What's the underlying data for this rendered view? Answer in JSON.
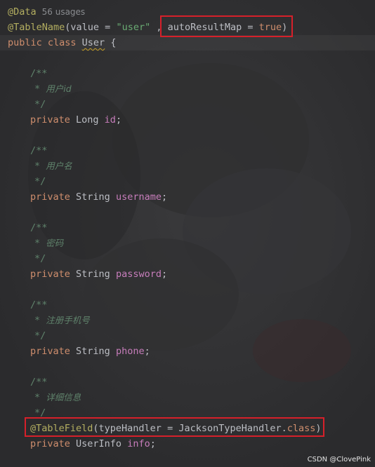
{
  "header": {
    "data_annotation": "@Data",
    "usages": "56 usages",
    "tablename_annotation": "@TableName",
    "tablename_args_start": "(value = ",
    "tablename_value": "\"user\"",
    "tablename_sep": " , ",
    "automap_key": "autoResultMap = ",
    "automap_value": "true",
    "close_paren": ")",
    "class_kw": "public class ",
    "class_name": "User",
    "open_brace": " {"
  },
  "fields": [
    {
      "doc_open": "/**",
      "doc_text": "用户id",
      "doc_close": "*/",
      "modifier": "private ",
      "type": "Long ",
      "name": "id",
      "end": ";"
    },
    {
      "doc_open": "/**",
      "doc_text": "用户名",
      "doc_close": "*/",
      "modifier": "private ",
      "type": "String ",
      "name": "username",
      "end": ";"
    },
    {
      "doc_open": "/**",
      "doc_text": "密码",
      "doc_close": "*/",
      "modifier": "private ",
      "type": "String ",
      "name": "password",
      "end": ";"
    },
    {
      "doc_open": "/**",
      "doc_text": "注册手机号",
      "doc_close": "*/",
      "modifier": "private ",
      "type": "String ",
      "name": "phone",
      "end": ";"
    },
    {
      "doc_open": "/**",
      "doc_text": "详细信息",
      "doc_close": "*/",
      "field_annotation": "@TableField",
      "field_annotation_args": "(typeHandler = JacksonTypeHandler.",
      "field_annotation_class": "class",
      "field_annotation_close": ")",
      "modifier": "private ",
      "type": "UserInfo ",
      "name": "info",
      "end": ";"
    }
  ],
  "doc_star": "* ",
  "watermark": "CSDN @ClovePink",
  "colors": {
    "annotation": "#b3ae60",
    "keyword": "#cf8e6d",
    "string": "#6aab73",
    "field": "#c77dbb",
    "doc_comment": "#5f826b",
    "highlight_box": "#d6202a"
  }
}
